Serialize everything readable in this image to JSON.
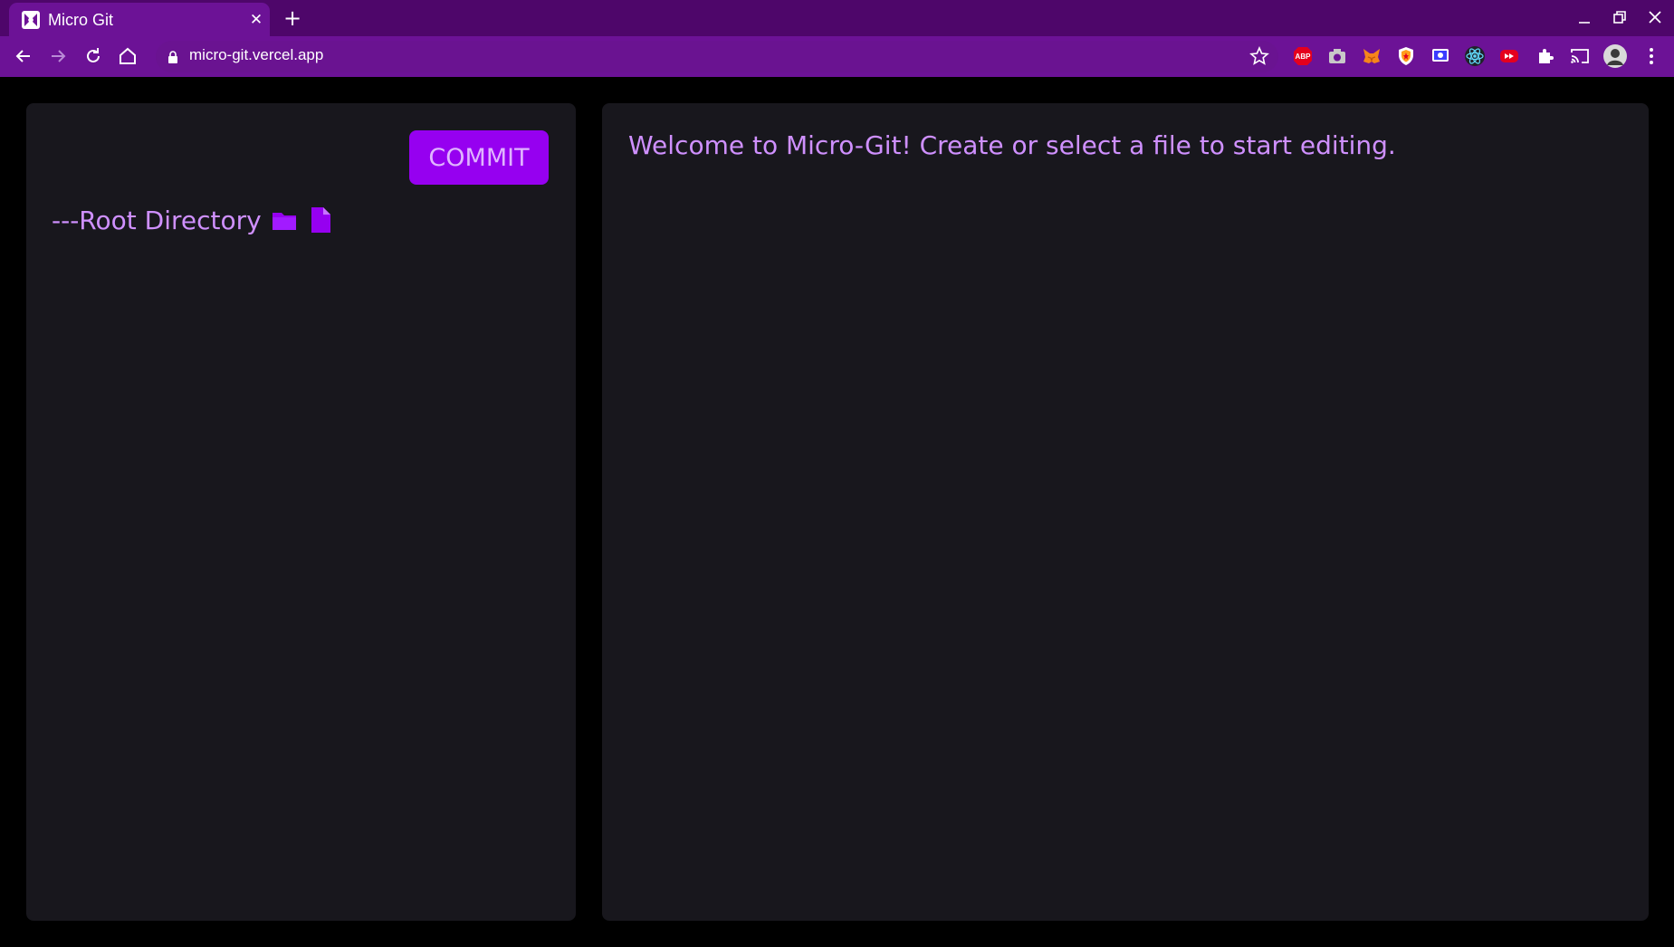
{
  "browser": {
    "tab": {
      "title": "Micro Git",
      "favicon": "micro-git-logo-icon",
      "close_glyph": "✕"
    },
    "new_tab_glyph": "+",
    "address": {
      "url": "micro-git.vercel.app"
    },
    "extensions": [
      {
        "name": "adblock-plus-icon",
        "label": "ABP",
        "color": "#e5001e"
      },
      {
        "name": "camera-icon",
        "color": "#c8c8c8"
      },
      {
        "name": "metamask-icon",
        "color": "#f6851b"
      },
      {
        "name": "shield-icon",
        "color": "#ff9f1c"
      },
      {
        "name": "screen-capture-icon",
        "color": "#3b3bff"
      },
      {
        "name": "react-devtools-icon",
        "color": "#61dafb"
      },
      {
        "name": "video-speed-icon",
        "color": "#e5001e"
      },
      {
        "name": "puzzle-icon",
        "color": "#ffffff"
      },
      {
        "name": "cast-icon",
        "color": "#ffffff"
      },
      {
        "name": "profile-avatar-icon",
        "color": "#888888"
      },
      {
        "name": "kebab-menu-icon",
        "color": "#ffffff"
      }
    ]
  },
  "colors": {
    "tabbar": "#4e066a",
    "toolbar": "#6c1296",
    "panel": "#18171d",
    "accent": "#9600f0",
    "text_accent": "#cf90ff"
  },
  "sidebar": {
    "commit_label": "COMMIT",
    "root_label": "---Root Directory",
    "icons": [
      "new-folder-icon",
      "new-file-icon"
    ]
  },
  "editor": {
    "welcome_text": "Welcome to Micro-Git! Create or select a file to start editing."
  }
}
